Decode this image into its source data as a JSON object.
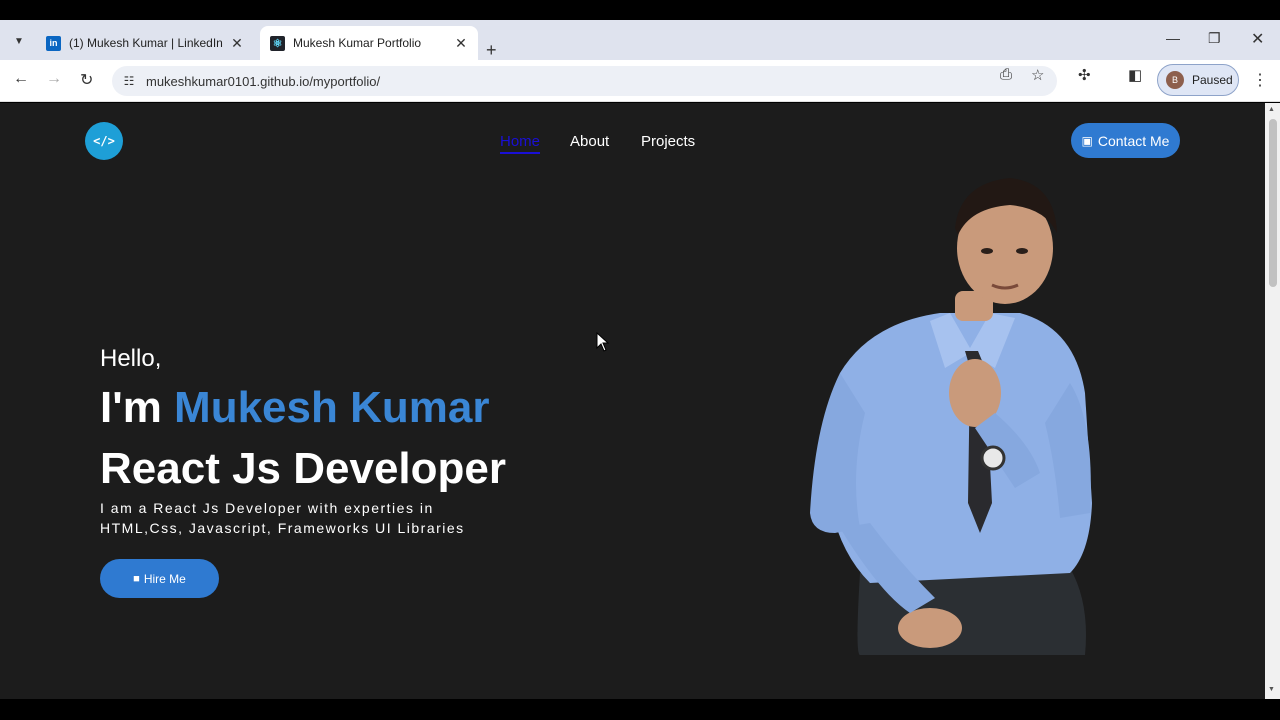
{
  "browser": {
    "tabs": [
      {
        "title": "(1) Mukesh Kumar | LinkedIn",
        "favicon": "linkedin-icon"
      },
      {
        "title": "Mukesh Kumar Portfolio",
        "favicon": "react-icon"
      }
    ],
    "url": "mukeshkumar0101.github.io/myportfolio/",
    "profile": {
      "initial": "B",
      "status": "Paused"
    }
  },
  "site": {
    "logo_text": "</>",
    "nav": {
      "home": "Home",
      "about": "About",
      "projects": "Projects"
    },
    "contact_label": "Contact Me",
    "hero": {
      "greeting": "Hello,",
      "intro_prefix": "I'm",
      "name": "Mukesh Kumar",
      "role": "React Js Developer",
      "description": "I am a React Js Developer with experties in HTML,Css, Javascript, Frameworks UI Libraries",
      "hire_label": "Hire Me"
    }
  },
  "colors": {
    "accent": "#2f7ad1",
    "name_blue": "#3a86d5",
    "active_nav": "#1a0fd6",
    "page_bg": "#1c1c1c"
  }
}
